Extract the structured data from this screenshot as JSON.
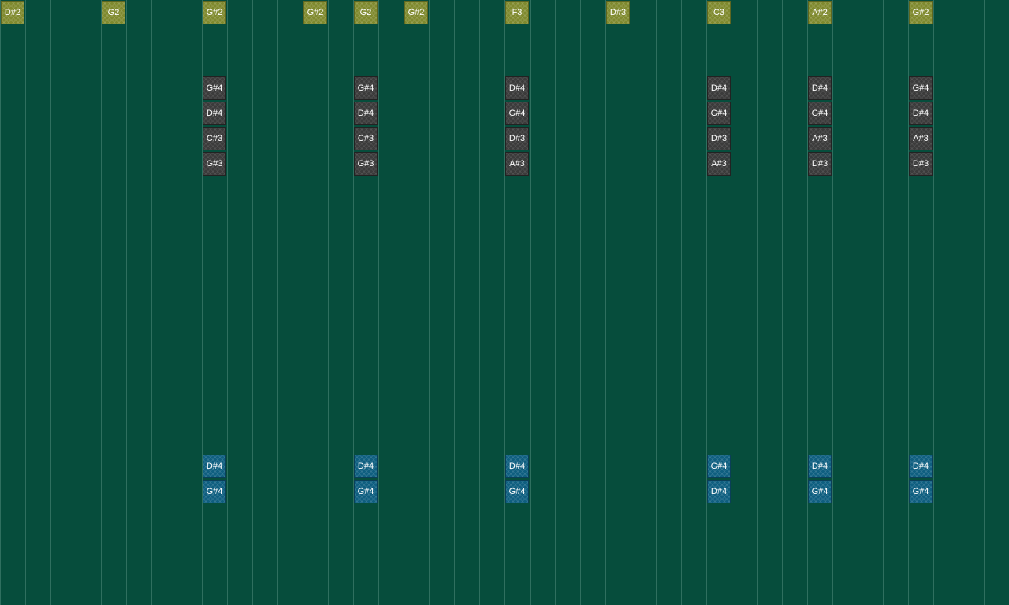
{
  "colors": {
    "background": "#064d3c",
    "grid_line": "#2f6f5f",
    "bass_note": "#7f8a2e",
    "chord_note": "#3b3b3b",
    "lead_note": "#0f5f80",
    "note_text": "#ffffff"
  },
  "bass_notes": [
    {
      "step": 0,
      "row": 0,
      "label": "D#2"
    },
    {
      "step": 4,
      "row": 0,
      "label": "G2"
    },
    {
      "step": 8,
      "row": 0,
      "label": "G#2"
    },
    {
      "step": 12,
      "row": 0,
      "label": "G#2"
    },
    {
      "step": 14,
      "row": 0,
      "label": "G2"
    },
    {
      "step": 16,
      "row": 0,
      "label": "G#2"
    },
    {
      "step": 20,
      "row": 0,
      "label": "F3"
    },
    {
      "step": 24,
      "row": 0,
      "label": "D#3"
    },
    {
      "step": 28,
      "row": 0,
      "label": "C3"
    },
    {
      "step": 32,
      "row": 0,
      "label": "A#2"
    },
    {
      "step": 36,
      "row": 0,
      "label": "G#2"
    }
  ],
  "chord_notes": [
    {
      "step": 8,
      "row": 3,
      "label": "G#4"
    },
    {
      "step": 8,
      "row": 4,
      "label": "D#4"
    },
    {
      "step": 8,
      "row": 5,
      "label": "C#3"
    },
    {
      "step": 8,
      "row": 6,
      "label": "G#3"
    },
    {
      "step": 14,
      "row": 3,
      "label": "G#4"
    },
    {
      "step": 14,
      "row": 4,
      "label": "D#4"
    },
    {
      "step": 14,
      "row": 5,
      "label": "C#3"
    },
    {
      "step": 14,
      "row": 6,
      "label": "G#3"
    },
    {
      "step": 20,
      "row": 3,
      "label": "D#4"
    },
    {
      "step": 20,
      "row": 4,
      "label": "G#4"
    },
    {
      "step": 20,
      "row": 5,
      "label": "D#3"
    },
    {
      "step": 20,
      "row": 6,
      "label": "A#3"
    },
    {
      "step": 28,
      "row": 3,
      "label": "D#4"
    },
    {
      "step": 28,
      "row": 4,
      "label": "G#4"
    },
    {
      "step": 28,
      "row": 5,
      "label": "D#3"
    },
    {
      "step": 28,
      "row": 6,
      "label": "A#3"
    },
    {
      "step": 32,
      "row": 3,
      "label": "D#4"
    },
    {
      "step": 32,
      "row": 4,
      "label": "G#4"
    },
    {
      "step": 32,
      "row": 5,
      "label": "A#3"
    },
    {
      "step": 32,
      "row": 6,
      "label": "D#3"
    },
    {
      "step": 36,
      "row": 3,
      "label": "G#4"
    },
    {
      "step": 36,
      "row": 4,
      "label": "D#4"
    },
    {
      "step": 36,
      "row": 5,
      "label": "A#3"
    },
    {
      "step": 36,
      "row": 6,
      "label": "D#3"
    }
  ],
  "lead_notes": [
    {
      "step": 8,
      "row": 18,
      "label": "D#4"
    },
    {
      "step": 8,
      "row": 19,
      "label": "G#4"
    },
    {
      "step": 14,
      "row": 18,
      "label": "D#4"
    },
    {
      "step": 14,
      "row": 19,
      "label": "G#4"
    },
    {
      "step": 20,
      "row": 18,
      "label": "D#4"
    },
    {
      "step": 20,
      "row": 19,
      "label": "G#4"
    },
    {
      "step": 28,
      "row": 18,
      "label": "G#4"
    },
    {
      "step": 28,
      "row": 19,
      "label": "D#4"
    },
    {
      "step": 32,
      "row": 18,
      "label": "D#4"
    },
    {
      "step": 32,
      "row": 19,
      "label": "G#4"
    },
    {
      "step": 36,
      "row": 18,
      "label": "D#4"
    },
    {
      "step": 36,
      "row": 19,
      "label": "G#4"
    }
  ]
}
